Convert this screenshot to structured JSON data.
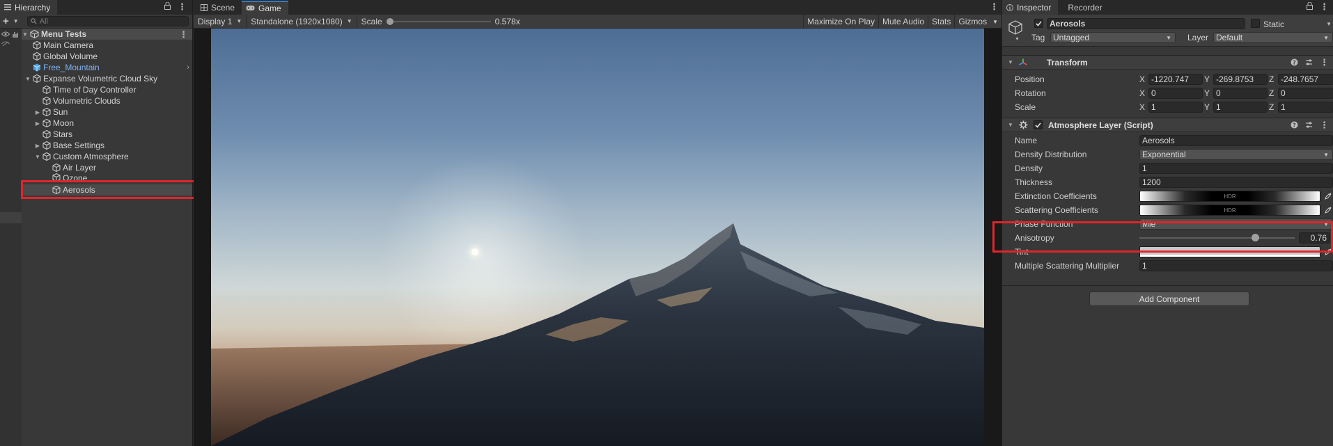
{
  "hierarchy": {
    "tab_label": "Hierarchy",
    "search_placeholder": "All",
    "scene_name": "Menu Tests",
    "items": [
      {
        "label": "Main Camera"
      },
      {
        "label": "Global Volume"
      },
      {
        "label": "Free_Mountain"
      },
      {
        "label": "Expanse Volumetric Cloud Sky"
      },
      {
        "label": "Time of Day Controller"
      },
      {
        "label": "Volumetric Clouds"
      },
      {
        "label": "Sun"
      },
      {
        "label": "Moon"
      },
      {
        "label": "Stars"
      },
      {
        "label": "Base Settings"
      },
      {
        "label": "Custom Atmosphere"
      },
      {
        "label": "Air Layer"
      },
      {
        "label": "Ozone"
      },
      {
        "label": "Aerosols"
      }
    ]
  },
  "game": {
    "tabs": [
      {
        "label": "Scene"
      },
      {
        "label": "Game"
      }
    ],
    "display": "Display 1",
    "resolution": "Standalone (1920x1080)",
    "scale_label": "Scale",
    "scale_value": "0.578x",
    "scale_fraction": 0.0,
    "buttons": {
      "maximize": "Maximize On Play",
      "mute": "Mute Audio",
      "stats": "Stats",
      "gizmos": "Gizmos"
    }
  },
  "inspector": {
    "tabs": [
      {
        "label": "Inspector"
      },
      {
        "label": "Recorder"
      }
    ],
    "object_name": "Aerosols",
    "static_label": "Static",
    "tag_label": "Tag",
    "tag_value": "Untagged",
    "layer_label": "Layer",
    "layer_value": "Default",
    "transform": {
      "title": "Transform",
      "position": {
        "label": "Position",
        "x": "-1220.747",
        "y": "-269.8753",
        "z": "-248.7657"
      },
      "rotation": {
        "label": "Rotation",
        "x": "0",
        "y": "0",
        "z": "0"
      },
      "scale": {
        "label": "Scale",
        "x": "1",
        "y": "1",
        "z": "1"
      }
    },
    "atmosphere": {
      "title": "Atmosphere Layer (Script)",
      "name": {
        "label": "Name",
        "value": "Aerosols"
      },
      "density_distribution": {
        "label": "Density Distribution",
        "value": "Exponential"
      },
      "density": {
        "label": "Density",
        "value": "1"
      },
      "thickness": {
        "label": "Thickness",
        "value": "1200"
      },
      "extinction": {
        "label": "Extinction Coefficients",
        "badge": "HDR"
      },
      "scattering": {
        "label": "Scattering Coefficients",
        "badge": "HDR"
      },
      "phase_function": {
        "label": "Phase Function",
        "value": "Mie"
      },
      "anisotropy": {
        "label": "Anisotropy",
        "value": "0.76",
        "fraction": 0.76
      },
      "tint": {
        "label": "Tint"
      },
      "multiple_scattering": {
        "label": "Multiple Scattering Multiplier",
        "value": "1"
      }
    },
    "add_component": "Add Component"
  },
  "colors": {
    "accent": "#3a79bb",
    "highlight_box": "#e0252b",
    "prefab_text": "#7fb2f0"
  }
}
